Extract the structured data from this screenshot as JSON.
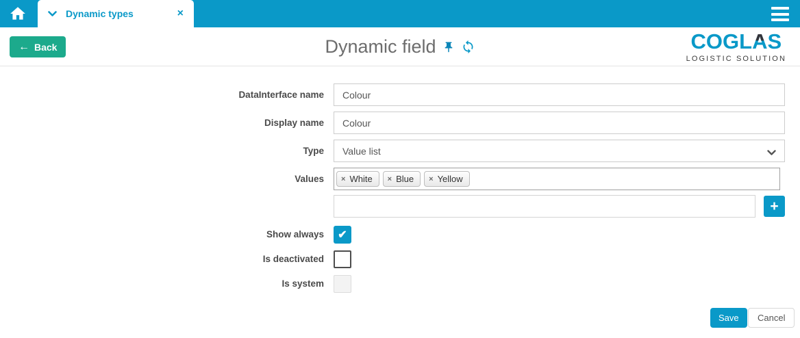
{
  "topbar": {
    "tab_label": "Dynamic types",
    "close_label": "×"
  },
  "header": {
    "back_arrow": "←",
    "back_label": "Back",
    "title": "Dynamic field",
    "logo": {
      "part1": "COGL",
      "a": "A",
      "part2": "S",
      "subtitle": "LOGISTIC SOLUTION"
    }
  },
  "form": {
    "datainterface_name": {
      "label": "DataInterface name",
      "value": "Colour"
    },
    "display_name": {
      "label": "Display name",
      "value": "Colour"
    },
    "type": {
      "label": "Type",
      "value": "Value list"
    },
    "values": {
      "label": "Values",
      "tags": [
        "White",
        "Blue",
        "Yellow"
      ],
      "remove_label": "×"
    },
    "new_value": {
      "value": "",
      "add_label": "+"
    },
    "show_always": {
      "label": "Show always",
      "checked": true
    },
    "is_deactivated": {
      "label": "Is deactivated",
      "checked": false
    },
    "is_system": {
      "label": "Is system",
      "checked": false,
      "disabled": true
    },
    "save_label": "Save",
    "cancel_label": "Cancel"
  },
  "colors": {
    "accent": "#0a99c8",
    "back_green": "#1caa8c",
    "title_gray": "#6d6d6d"
  }
}
